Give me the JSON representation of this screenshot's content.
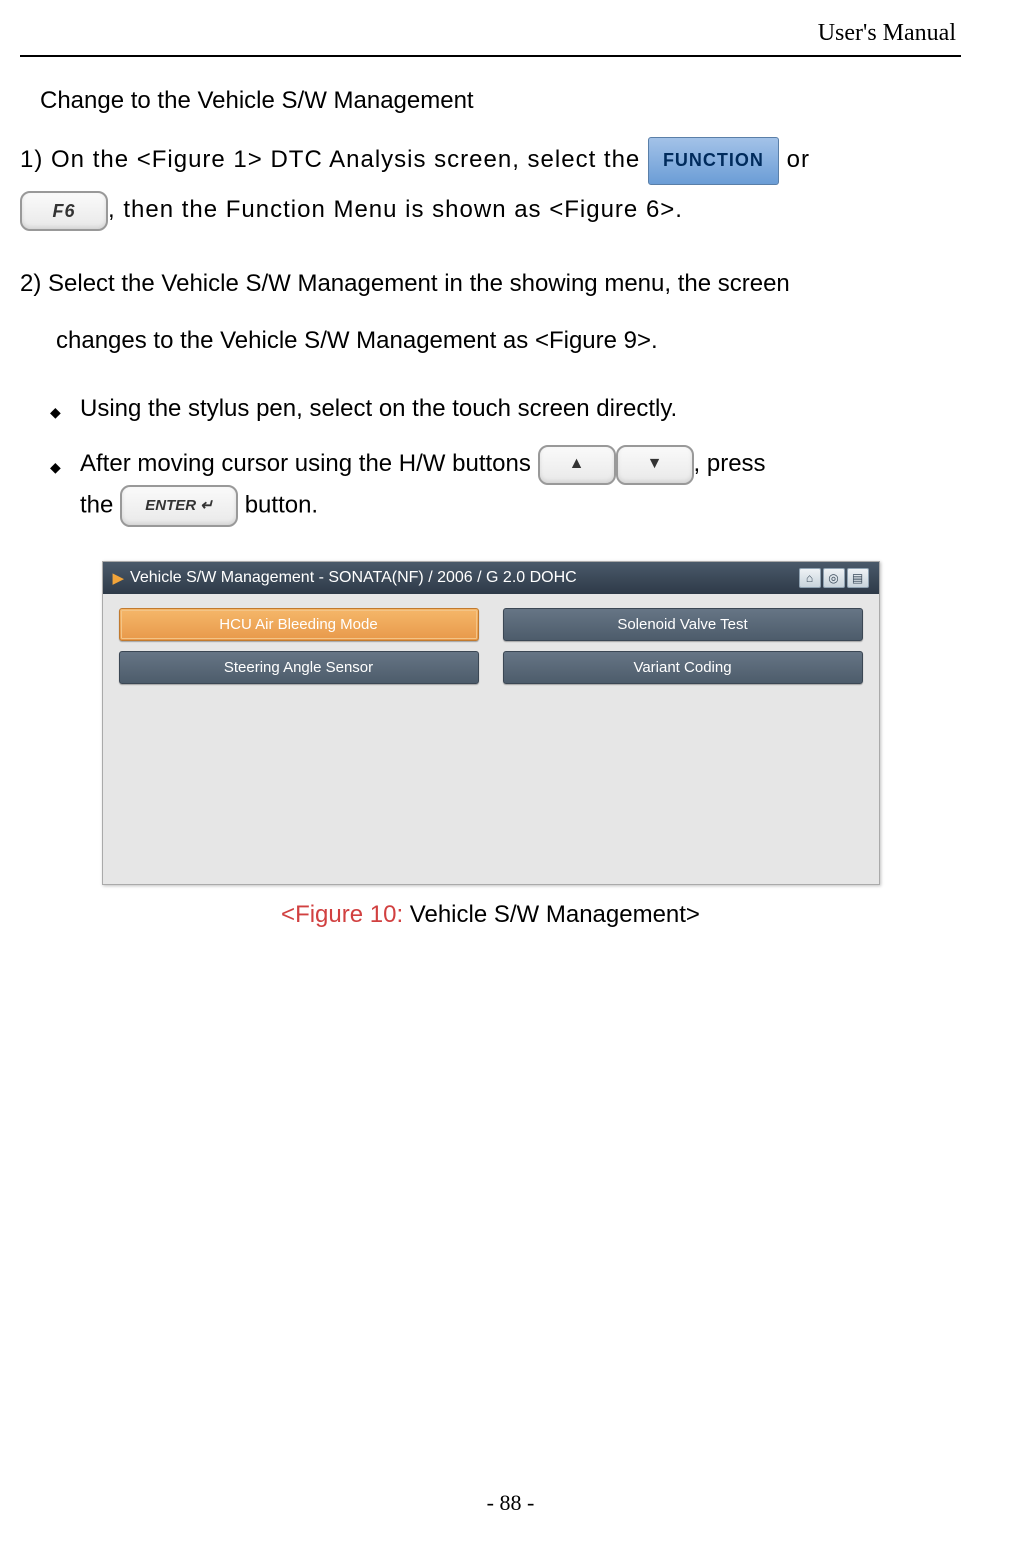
{
  "header": {
    "title": "User's Manual"
  },
  "section": {
    "title": "Change to the Vehicle S/W Management"
  },
  "steps": {
    "s1": {
      "prefix": "1)  On  the  <Figure  1>  DTC  Analysis  screen,  select  the ",
      "function_label": "FUNCTION",
      "mid": " or ",
      "f6_label": "F6",
      "suffix": ", then the Function Menu is shown as <Figure 6>."
    },
    "s2": {
      "line1": "2)  Select the Vehicle S/W Management in the showing menu, the screen",
      "line2": "changes to the Vehicle S/W Management as <Figure 9>."
    }
  },
  "bullets": {
    "b1": "Using the stylus pen, select on the touch screen directly.",
    "b2": {
      "p1": "After moving cursor using the H/W buttons ",
      "arrow_up": "▲",
      "arrow_down": "▼",
      "p2": ", press",
      "p3": "the ",
      "enter_label": "ENTER ↵",
      "p4": " button."
    }
  },
  "figure": {
    "titlebar": {
      "arrow": "▶",
      "text": "Vehicle S/W Management - SONATA(NF) / 2006 / G 2.0 DOHC",
      "icon1": "⌂",
      "icon2": "◎",
      "icon3": "▤"
    },
    "buttons": {
      "b1": "HCU Air Bleeding Mode",
      "b2": "Solenoid Valve Test",
      "b3": "Steering Angle Sensor",
      "b4": "Variant Coding"
    },
    "caption_red": "<Figure 10:",
    "caption_black": " Vehicle S/W Management>"
  },
  "footer": {
    "page": "- 88 -"
  }
}
